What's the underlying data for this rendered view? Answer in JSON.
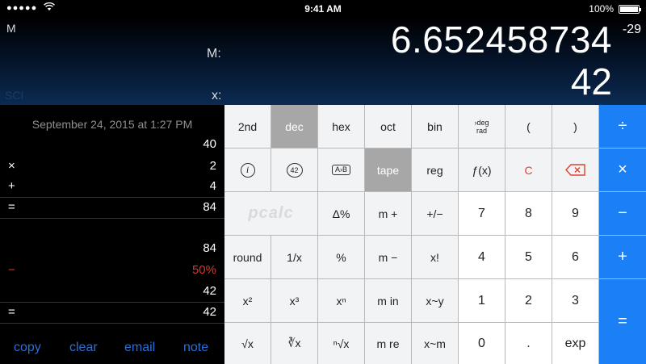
{
  "status": {
    "signal": "●●●●●",
    "time": "9:41 AM",
    "battery_pct": "100%",
    "battery_level": 1.0
  },
  "display": {
    "memory_flag": "M",
    "sci_flag": "SCI",
    "m_label": "M:",
    "x_label": "x:",
    "m_value": "6.652458734",
    "m_exponent": "-29",
    "x_value": "42"
  },
  "tape": {
    "date": "September 24, 2015 at 1:27 PM",
    "lines": [
      {
        "op": "",
        "value": "40"
      },
      {
        "op": "×",
        "value": "2"
      },
      {
        "op": "+",
        "value": "4"
      },
      {
        "op": "=",
        "value": "84"
      },
      {
        "op": "",
        "value": "84"
      },
      {
        "op": "−",
        "value": "50%"
      },
      {
        "op": "",
        "value": "42"
      },
      {
        "op": "=",
        "value": "42"
      }
    ],
    "actions": {
      "copy": "copy",
      "clear": "clear",
      "email": "email",
      "note": "note"
    }
  },
  "keypad": {
    "row1": {
      "second": "2nd",
      "dec": "dec",
      "hex": "hex",
      "oct": "oct",
      "bin": "bin",
      "degrad_top": "›deg",
      "degrad_bottom": "rad",
      "lparen": "(",
      "rparen": ")",
      "divide": "÷"
    },
    "row2": {
      "info": "i",
      "const": "42",
      "ab": "A›B",
      "tape": "tape",
      "reg": "reg",
      "fx": "ƒ(x)",
      "clear": "C",
      "multiply": "×"
    },
    "row3": {
      "logo": "pcalc",
      "delta_pct": "Δ%",
      "m_plus": "m +",
      "plus_minus": "+/−",
      "seven": "7",
      "eight": "8",
      "nine": "9",
      "minus": "−"
    },
    "row4": {
      "round": "round",
      "recip": "1/x",
      "pct": "%",
      "m_minus": "m −",
      "fact": "x!",
      "four": "4",
      "five": "5",
      "six": "6",
      "plus": "+"
    },
    "row5": {
      "x2": "x²",
      "x3": "x³",
      "xn": "xⁿ",
      "m_in": "m in",
      "x_swap_y": "x~y",
      "one": "1",
      "two": "2",
      "three": "3",
      "equals": "="
    },
    "row6": {
      "sqrt": "√x",
      "cbrt": "∛x",
      "nrt": "ⁿ√x",
      "m_re": "m re",
      "x_swap_m": "x~m",
      "zero": "0",
      "dot": ".",
      "exp": "exp"
    }
  }
}
